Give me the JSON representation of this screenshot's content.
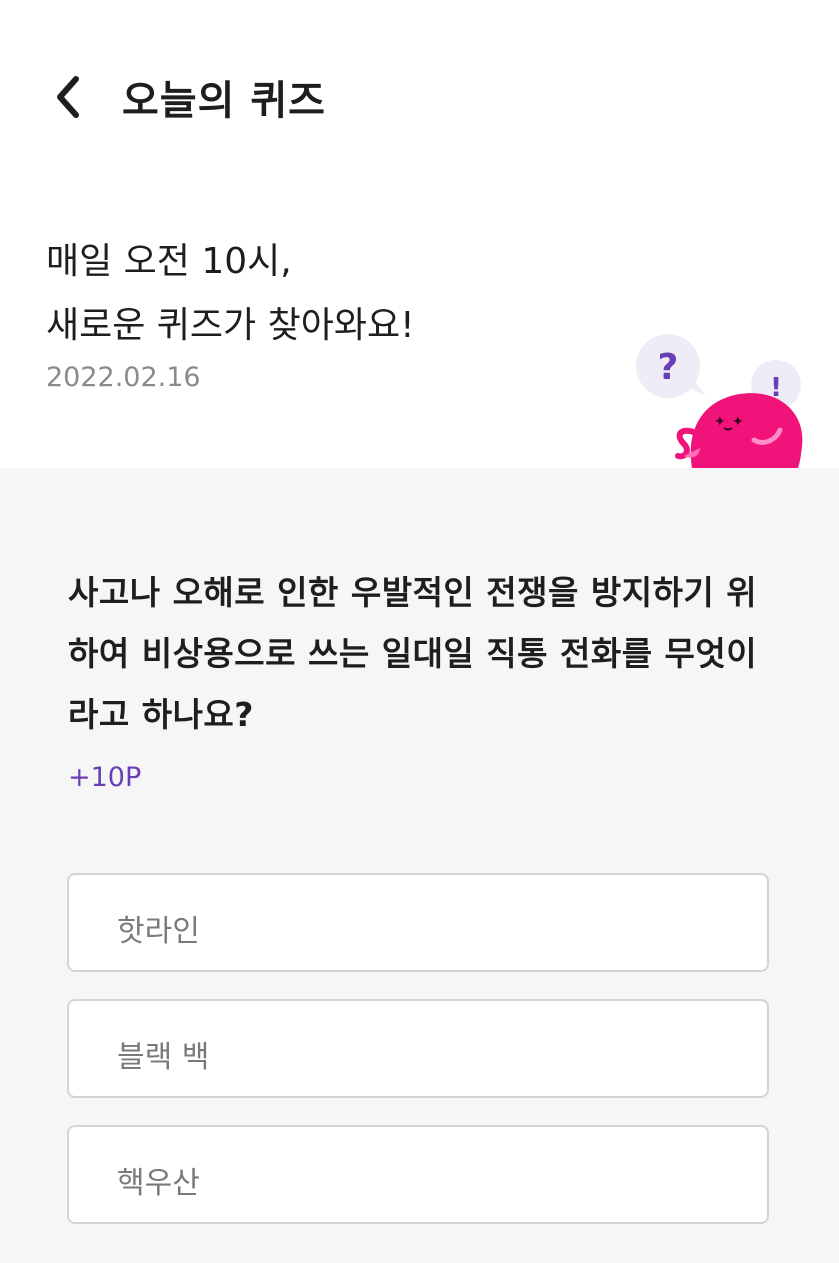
{
  "header": {
    "title": "오늘의 퀴즈"
  },
  "hero": {
    "line1": "매일 오전 10시,",
    "line2": "새로운 퀴즈가 찾아와요!",
    "date": "2022.02.16",
    "bubble_left": "?",
    "bubble_right": "!"
  },
  "quiz": {
    "question": "사고나 오해로 인한 우발적인 전쟁을 방지하기 위하여 비상용으로 쓰는 일대일 직통 전화를 무엇이라고 하나요?",
    "points": "+10P",
    "options": [
      {
        "label": "핫라인"
      },
      {
        "label": "블랙 백"
      },
      {
        "label": "핵우산"
      }
    ]
  },
  "colors": {
    "accent": "#6a3fb5",
    "mascot": "#f0147a",
    "background_gray": "#f6f6f6"
  }
}
